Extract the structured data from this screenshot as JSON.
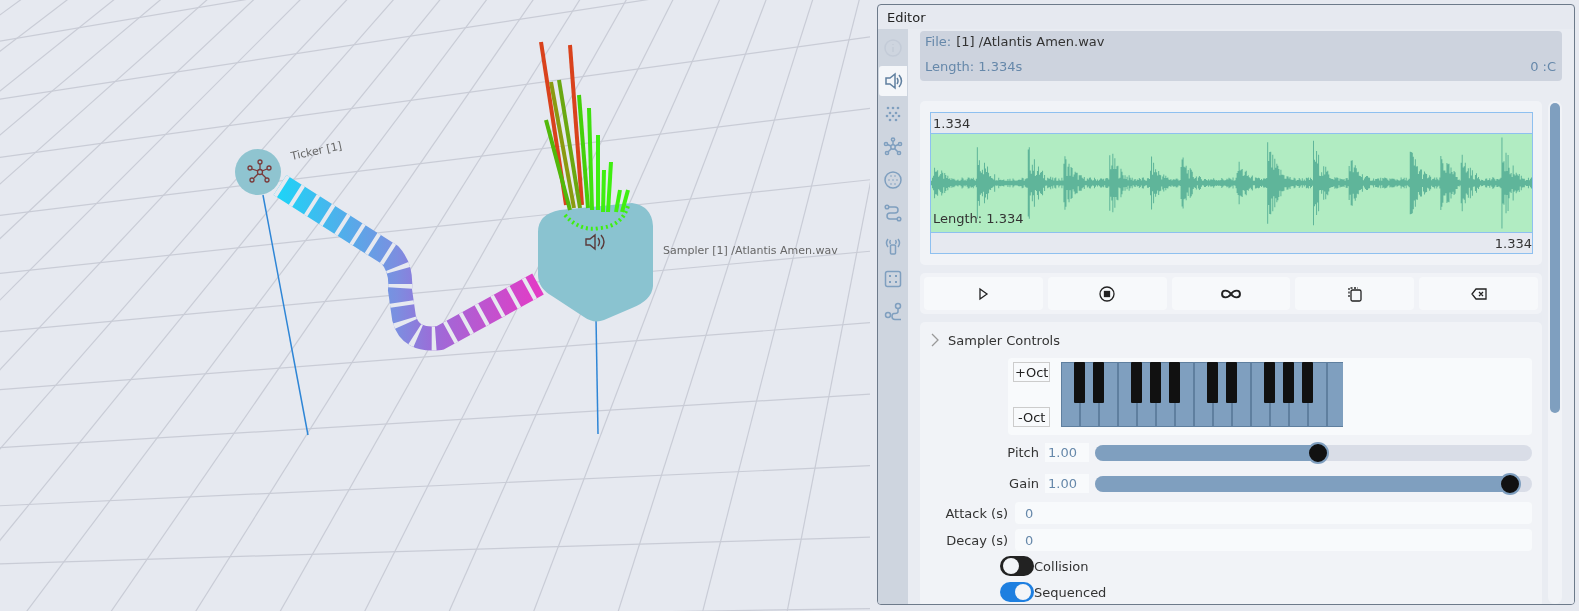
{
  "scene": {
    "nodes": [
      {
        "kind": "ticker",
        "label": "Ticker [1]"
      },
      {
        "kind": "sampler",
        "label": "Sampler [1] /Atlantis Amen.wav"
      }
    ]
  },
  "editor": {
    "title": "Editor",
    "sidebar_tabs": [
      {
        "selected": false,
        "disabled": true
      },
      {
        "selected": true,
        "disabled": false
      },
      {
        "selected": false,
        "disabled": false
      },
      {
        "selected": false,
        "disabled": false
      },
      {
        "selected": false,
        "disabled": false
      },
      {
        "selected": false,
        "disabled": false
      },
      {
        "selected": false,
        "disabled": false
      },
      {
        "selected": false,
        "disabled": false
      },
      {
        "selected": false,
        "disabled": false
      }
    ],
    "file": {
      "label": "File:",
      "value": "[1] /Atlantis Amen.wav",
      "length": "Length: 1.334s",
      "position": "0 :C"
    },
    "waveform": {
      "top_value": "1.334",
      "length_label": "Length: 1.334",
      "bottom_value": "1.334"
    },
    "section": {
      "title": "Sampler Controls"
    },
    "octave_buttons": [
      "+Oct",
      "-Oct"
    ],
    "sliders": [
      {
        "label": "Pitch",
        "value": "1.00",
        "level": 0.51
      },
      {
        "label": "Gain",
        "value": "1.00",
        "level": 0.95
      }
    ],
    "fields": [
      {
        "label": "Attack (s)",
        "value": "0"
      },
      {
        "label": "Decay (s)",
        "value": "0"
      }
    ],
    "toggles": [
      {
        "label": "Collision",
        "on": false
      },
      {
        "label": "Sequenced",
        "on": true
      }
    ]
  }
}
